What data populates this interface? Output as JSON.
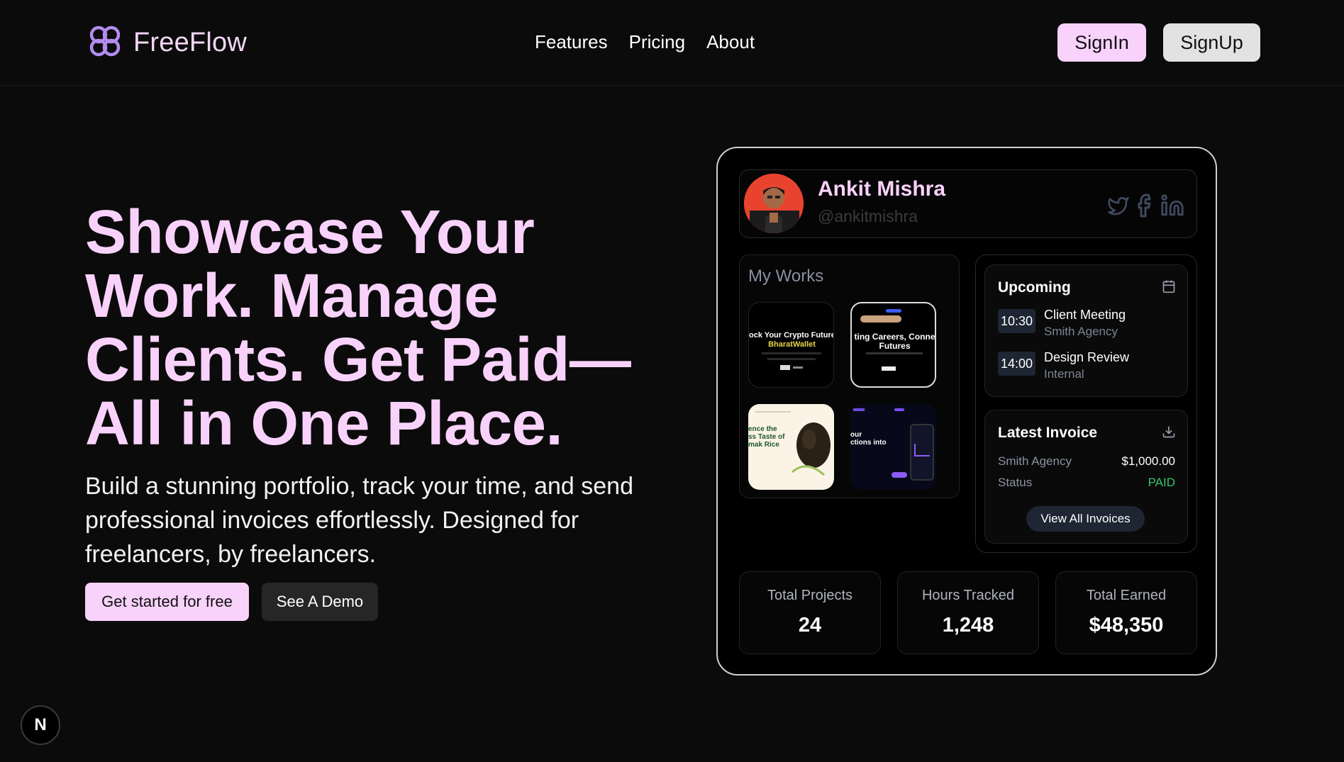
{
  "nav": {
    "brand": "FreeFlow",
    "links": [
      "Features",
      "Pricing",
      "About"
    ],
    "signin_label": "SignIn",
    "signup_label": "SignUp"
  },
  "hero": {
    "title": "Showcase Your Work. Manage Clients. Get Paid—All in One Place.",
    "subtitle": "Build a stunning portfolio, track your time, and send professional invoices effortlessly. Designed for freelancers, by freelancers.",
    "primary_cta": "Get started for free",
    "secondary_cta": "See A Demo"
  },
  "next_badge": "N",
  "dashboard": {
    "profile": {
      "name": "Ankit Mishra",
      "handle": "@ankitmishra",
      "socials": [
        "twitter-icon",
        "facebook-icon",
        "linkedin-icon"
      ]
    },
    "works": {
      "title": "My Works",
      "items": [
        {
          "line1": "ock Your Crypto Future w",
          "line2": "BharatWallet"
        },
        {
          "line1": "ting Careers, Conne",
          "line2": "Futures"
        },
        {
          "line1": "ence the",
          "line2": "ss Taste of",
          "line3": "mak Rice"
        },
        {
          "line1": "our",
          "line2": "ctions into"
        }
      ]
    },
    "upcoming": {
      "title": "Upcoming",
      "events": [
        {
          "time": "10:30",
          "title": "Client Meeting",
          "sub": "Smith Agency"
        },
        {
          "time": "14:00",
          "title": "Design Review",
          "sub": "Internal"
        }
      ]
    },
    "invoice": {
      "title": "Latest Invoice",
      "client": "Smith Agency",
      "amount": "$1,000.00",
      "status_label": "Status",
      "status": "PAID",
      "button": "View All Invoices"
    },
    "stats": [
      {
        "label": "Total Projects",
        "value": "24"
      },
      {
        "label": "Hours Tracked",
        "value": "1,248"
      },
      {
        "label": "Total Earned",
        "value": "$48,350"
      }
    ]
  },
  "colors": {
    "accent": "#f9d2fb",
    "background": "#0b0b0b",
    "paid": "#3ac26b",
    "logo": "#b48cf0"
  }
}
